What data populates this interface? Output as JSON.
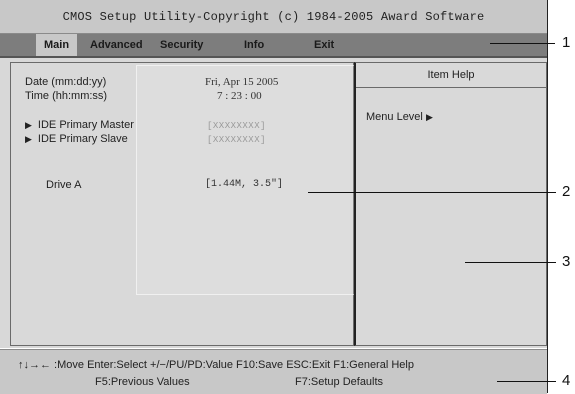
{
  "title": "CMOS Setup Utility-Copyright (c) 1984-2005 Award Software",
  "menu": [
    {
      "label": "Main",
      "active": true
    },
    {
      "label": "Advanced",
      "active": false
    },
    {
      "label": "Security",
      "active": false
    },
    {
      "label": "Info",
      "active": false
    },
    {
      "label": "Exit",
      "active": false
    }
  ],
  "fields": {
    "date_label": "Date (mm:dd:yy)",
    "date_value": "Fri, Apr 15 2005",
    "time_label": "Time (hh:mm:ss)",
    "time_value": "7 : 23 : 00",
    "ide_master_label": "IDE Primary Master",
    "ide_master_value": "[XXXXXXXX]",
    "ide_slave_label": "IDE Primary Slave",
    "ide_slave_value": "[XXXXXXXX]",
    "drive_a_label": "Drive A",
    "drive_a_value": "[1.44M, 3.5\"]"
  },
  "help": {
    "title": "Item Help",
    "menu_level": "Menu Level",
    "menu_level_arrow": "▶"
  },
  "footer": {
    "line1": "↑↓→← :Move   Enter:Select  +/−/PU/PD:Value   F10:Save   ESC:Exit   F1:General Help",
    "line2_left": "F5:Previous Values",
    "line2_right": "F7:Setup Defaults"
  },
  "callouts": [
    "1",
    "2",
    "3",
    "4"
  ],
  "icons": {
    "submenu_bullet": "▶"
  }
}
